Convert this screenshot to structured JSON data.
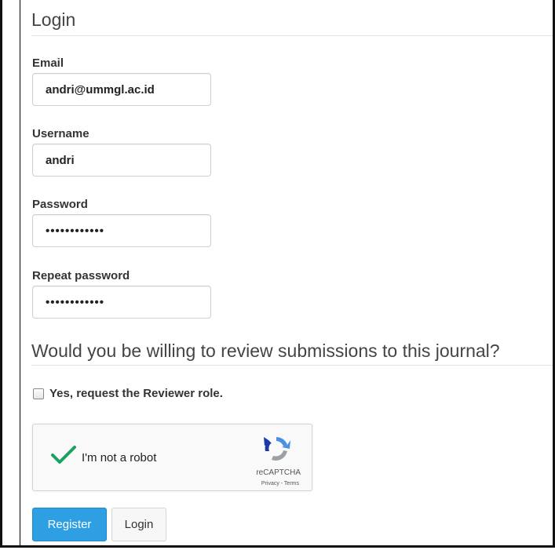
{
  "login_section": {
    "title": "Login"
  },
  "fields": {
    "email": {
      "label": "Email",
      "value": "andri@ummgl.ac.id"
    },
    "username": {
      "label": "Username",
      "value": "andri"
    },
    "password": {
      "label": "Password",
      "value": "••••••••••••"
    },
    "repeat_password": {
      "label": "Repeat password",
      "value": "••••••••••••"
    }
  },
  "reviewer_section": {
    "title": "Would you be willing to review submissions to this journal?",
    "checkbox_label": "Yes, request the Reviewer role.",
    "checked": false
  },
  "captcha": {
    "label": "I'm not a robot",
    "brand": "reCAPTCHA",
    "links": "Privacy - Terms",
    "check_color": "#1aa260"
  },
  "buttons": {
    "register": "Register",
    "login": "Login"
  },
  "colors": {
    "primary": "#2f9fe3"
  }
}
